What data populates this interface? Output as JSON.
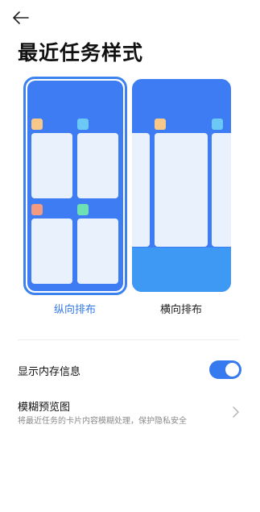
{
  "page": {
    "title": "最近任务样式"
  },
  "layout_options": {
    "selected": "vertical",
    "vertical_label": "纵向排布",
    "horizontal_label": "横向排布"
  },
  "settings": {
    "show_memory": {
      "title": "显示内存信息",
      "enabled": true
    },
    "blur_preview": {
      "title": "模糊预览图",
      "subtitle": "将最近任务的卡片内容模糊处理，保护隐私安全"
    }
  },
  "icons": {
    "back": "back-arrow-icon",
    "chevron": "chevron-right-icon"
  },
  "colors": {
    "accent": "#3478e8",
    "preview_blue": "#3d7cf2",
    "preview_band": "#3e99f5",
    "tile": "#e8f1fc",
    "app_orange": "#f7c88a",
    "app_cyan": "#6cc8f5",
    "app_salmon": "#f29b80",
    "app_green": "#6de0b4"
  }
}
